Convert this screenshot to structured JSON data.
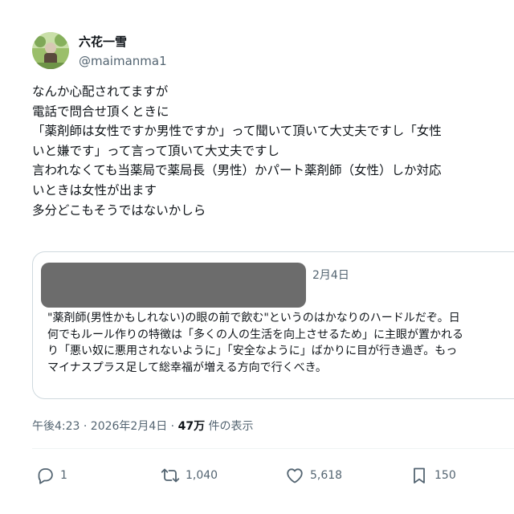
{
  "author": {
    "display_name": "六花一雪",
    "handle": "@maimanma1"
  },
  "tweet_lines": [
    "なんか心配されてますが",
    "電話で問合せ頂くときに",
    "「薬剤師は女性ですか男性ですか」って聞いて頂いて大丈夫ですし「女性",
    "いと嫌です」って言って頂いて大丈夫ですし",
    "言われなくても当薬局で薬局長（男性）かパート薬剤師（女性）しか対応",
    "いときは女性が出ます",
    "多分どこもそうではないかしら"
  ],
  "quote": {
    "date": "2月4日",
    "lines": [
      "\"薬剤師(男性かもしれない)の眼の前で飲む\"というのはかなりのハードルだぞ。日",
      "何でもルール作りの特徴は「多くの人の生活を向上させるため」に主眼が置かれる",
      "り「悪い奴に悪用されないように」「安全なように」ばかりに目が行き過ぎ。もっ",
      "マイナスプラス足して総幸福が増える方向で行くべき。"
    ]
  },
  "meta": {
    "timestamp": "午後4:23 · 2026年2月4日 · ",
    "views_count": "47万",
    "views_label": " 件の表示"
  },
  "actions": {
    "reply": {
      "icon": "reply-icon",
      "count": "1"
    },
    "retweet": {
      "icon": "retweet-icon",
      "count": "1,040"
    },
    "like": {
      "icon": "heart-icon",
      "count": "5,618"
    },
    "bookmark": {
      "icon": "bookmark-icon",
      "count": "150"
    }
  },
  "colors": {
    "text": "#0f1419",
    "secondary": "#536471",
    "border": "#cfd9de",
    "redaction": "#6c6c6c"
  }
}
